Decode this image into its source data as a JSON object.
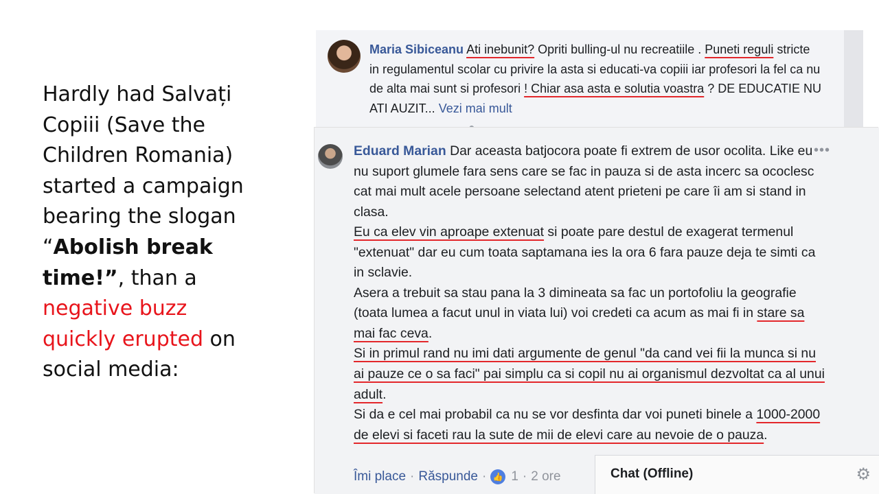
{
  "slide": {
    "line1": "Hardly had Salvați",
    "line2": "Copiii (Save the",
    "line3": "Children Romania)",
    "line4": "started a campaign",
    "line5": "bearing the slogan",
    "quote_open": "“",
    "slogan_part1": "Abolish break",
    "slogan_part2": "time!”",
    "after_slogan": ", than a",
    "red_line1": "negative buzz",
    "red_line2": "quickly erupted",
    "after_red": " on",
    "last_line": "social media:"
  },
  "comment1": {
    "author": "Maria Sibiceanu",
    "seg1": "Ati inebunit?",
    "seg2": " Opriti bulling-ul nu recreatiile . ",
    "seg3": "Puneti reguli",
    "seg4": " stricte in regulamentul scolar cu privire la asta si educati-va copiii iar profesori la fel ca nu de alta mai sunt si profesori ",
    "seg5": "! Chiar asa asta e solutia voastra",
    "seg6": " ? DE EDUCATIE NU ATI AUZIT... ",
    "see_more": "Vezi mai mult"
  },
  "comment2": {
    "author": "Eduard Marian",
    "p1": " Dar aceasta batjocora poate fi extrem de usor ocolita. Like eu nu suport glumele fara sens care se fac in pauza si de asta incerc sa ococlesc cat mai mult acele persoane selectand atent prieteni pe care îi am si stand in clasa.",
    "p2_ul": "Eu ca elev vin aproape extenuat",
    "p2_rest": " si poate pare destul de exagerat termenul \"extenuat\" dar eu cum toata saptamana ies la ora 6 fara pauze deja te simti ca in sclavie.",
    "p3_a": "Asera a trebuit sa stau pana la 3 dimineata sa fac un portofoliu la geografie (toata lumea a facut unul in viata lui) voi credeti ca acum as mai fi in ",
    "p3_ul": "stare sa mai fac ceva",
    "p3_end": ".",
    "p4_ul": "Si in primul rand nu imi dati argumente de genul \"da cand vei fii la munca si nu ai pauze ce o sa faci\" pai simplu ca si copil nu ai organismul dezvoltat ca al unui adult",
    "p4_end": ".",
    "p5_a": "Si da e cel mai probabil ca nu se vor desfinta dar voi puneti binele a ",
    "p5_ul": "1000-2000 de elevi si faceti rau la sute de mii de elevi care au nevoie de o pauza",
    "p5_end": ".",
    "like_label": "Îmi place",
    "reply_label": "Răspunde",
    "like_count": "1",
    "time": "2 ore"
  },
  "chat": {
    "title": "Chat (Offline)"
  }
}
